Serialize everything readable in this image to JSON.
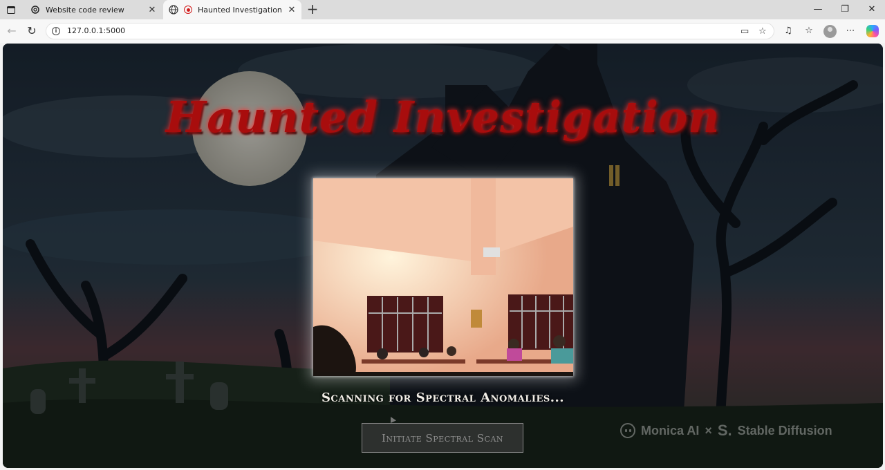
{
  "browser": {
    "tabs": [
      {
        "title": "Website code review",
        "active": false,
        "icon": "chatgpt-icon"
      },
      {
        "title": "Haunted Investigation",
        "active": true,
        "icon": "recording-icon"
      }
    ],
    "url": "127.0.0.1:5000",
    "colors": {
      "tabbar": "#dcdcdc",
      "toolbar": "#f7f7f7"
    }
  },
  "page": {
    "title": "Haunted Investigation",
    "status": "Scanning for Spectral Anomalies...",
    "scan_button": "Initiate Spectral Scan",
    "colors": {
      "title": "#a80d0d",
      "title_glow": "#ff2a2a",
      "status": "#f1ede6"
    }
  },
  "watermark": {
    "brand": "Monica AI",
    "separator": "×",
    "partner_mark": "S.",
    "partner": "Stable Diffusion"
  }
}
